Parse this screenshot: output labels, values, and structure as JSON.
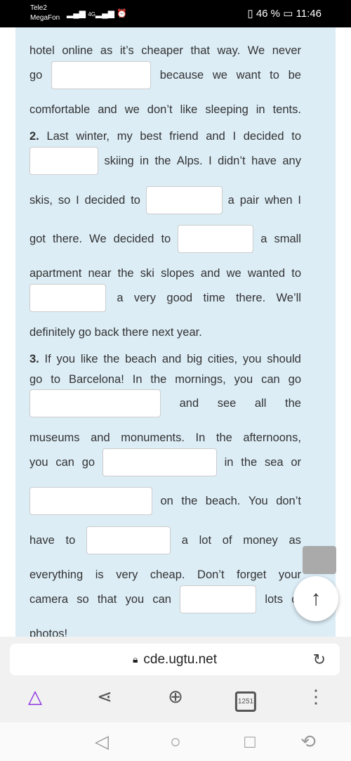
{
  "status": {
    "carrier1": "Tele2",
    "carrier2": "MegaFon",
    "network": "4G",
    "battery": "46 %",
    "time": "11:46"
  },
  "lines": [
    [
      "hotel",
      "online",
      "as",
      "it’s",
      "cheaper",
      "that",
      "way.",
      "We",
      "never"
    ],
    [
      "go",
      "#",
      "because",
      "we",
      "want",
      "to",
      "be"
    ],
    [
      "comfortable",
      "and",
      "we",
      "don’t",
      "like",
      "sleeping",
      "in",
      "tents."
    ],
    [
      "2.",
      "Last",
      "winter,",
      "my",
      "best",
      "friend",
      "and",
      "I",
      "decided",
      "to"
    ],
    [
      "#",
      "skiing",
      "in",
      "the",
      "Alps.",
      "I",
      "didn’t",
      "have",
      "any"
    ],
    [
      "skis,",
      "so",
      "I",
      "decided",
      "to",
      "#",
      "a",
      "pair",
      "when",
      "I"
    ],
    [
      "got",
      "there.",
      "We",
      "decided",
      "to",
      "#",
      "a",
      "small"
    ],
    [
      "apartment",
      "near",
      "the",
      "ski",
      "slopes",
      "and",
      "we",
      "wanted",
      "to"
    ],
    [
      "#",
      "a",
      "very",
      "good",
      "time",
      "there.",
      "We’ll"
    ],
    [
      "definitely go back there next year."
    ],
    [
      "3.",
      "If",
      "you",
      "like",
      "the",
      "beach",
      "and",
      "big",
      "cities,",
      "you",
      "should"
    ],
    [
      "go",
      "to",
      "Barcelona!",
      "In",
      "the",
      "mornings,",
      "you",
      "can",
      "go"
    ],
    [
      "#",
      "and",
      "see",
      "all",
      "the"
    ],
    [
      "museums",
      "and",
      "monuments.",
      "In",
      "the",
      "afternoons,"
    ],
    [
      "you",
      "can",
      "go",
      "#",
      "in",
      "the",
      "sea",
      "or"
    ],
    [
      "#",
      "on",
      "the",
      "beach.",
      "You",
      "don’t"
    ],
    [
      "have",
      "to",
      "#",
      "a",
      "lot",
      "of",
      "money",
      "as"
    ],
    [
      "everything",
      "is",
      "very",
      "cheap.",
      "Don’t",
      "forget",
      "your"
    ],
    [
      "camera",
      "so",
      "that",
      "you",
      "can",
      "#",
      "lots",
      "of"
    ],
    [
      "photos!"
    ]
  ],
  "browser": {
    "url": "cde.ugtu.net",
    "tabs_count": "1251",
    "accent": "#8a2be2"
  }
}
